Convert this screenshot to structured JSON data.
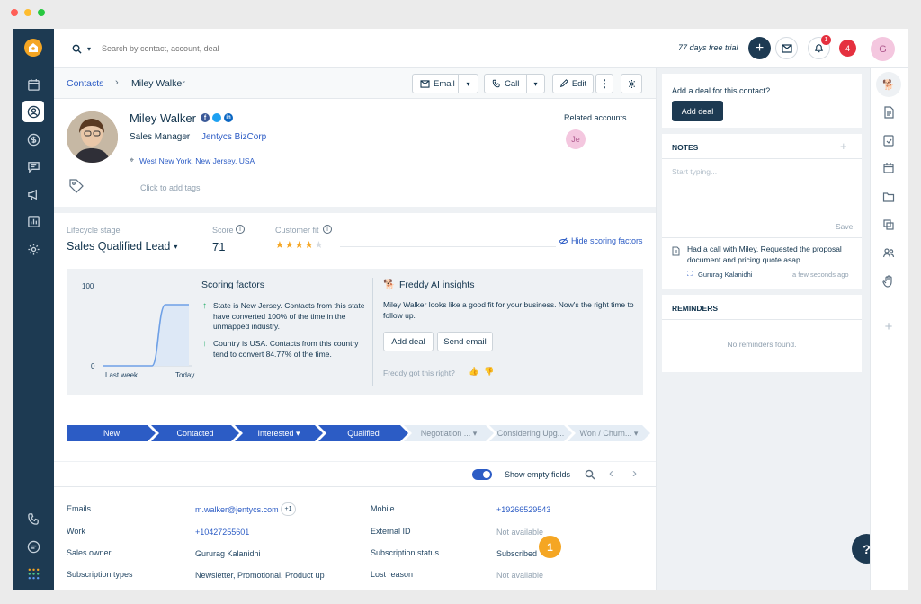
{
  "search": {
    "placeholder": "Search by contact, account, deal"
  },
  "topbar": {
    "trial": "77 days free trial",
    "notif_count": "1",
    "alerts_count": "4",
    "avatar": "G"
  },
  "breadcrumb": {
    "root": "Contacts",
    "current": "Miley Walker"
  },
  "actions": {
    "email": "Email",
    "call": "Call",
    "edit": "Edit"
  },
  "contact": {
    "name": "Miley Walker",
    "title": "Sales Manager",
    "company": "Jentycs BizCorp",
    "location": "West New York, New Jersey, USA",
    "tags_placeholder": "Click to add tags",
    "related_label": "Related accounts",
    "related_avatar": "Je"
  },
  "scoring": {
    "lifecycle_label": "Lifecycle stage",
    "lifecycle_value": "Sales Qualified Lead",
    "score_label": "Score",
    "score_value": "71",
    "fit_label": "Customer fit",
    "fit_stars": 4,
    "fit_max": 5,
    "hide_link": "Hide scoring factors",
    "factors_title": "Scoring factors",
    "factor1": "State is New Jersey. Contacts from this state have converted 100% of the time in the unmapped industry.",
    "factor2": "Country is USA. Contacts from this country tend to convert 84.77% of the time.",
    "y_max": "100",
    "y_min": "0",
    "x_left": "Last week",
    "x_right": "Today"
  },
  "freddy": {
    "title": "Freddy AI insights",
    "text": "Miley Walker looks like a good fit for your business. Now's the right time to follow up.",
    "add_deal": "Add deal",
    "send_email": "Send email",
    "feedback": "Freddy got this right?"
  },
  "pipeline": [
    {
      "label": "New",
      "state": "done"
    },
    {
      "label": "Contacted",
      "state": "done"
    },
    {
      "label": "Interested ▾",
      "state": "done"
    },
    {
      "label": "Qualified",
      "state": "done"
    },
    {
      "label": "Negotiation ... ▾",
      "state": "todo"
    },
    {
      "label": "Considering Upg...",
      "state": "todo"
    },
    {
      "label": "Won / Churn... ▾",
      "state": "todo"
    }
  ],
  "fields_toolbar": {
    "toggle_label": "Show empty fields"
  },
  "fields": {
    "emails_label": "Emails",
    "emails_value": "m.walker@jentycs.com",
    "emails_more": "+1",
    "work_label": "Work",
    "work_value": "+10427255601",
    "owner_label": "Sales owner",
    "owner_value": "Gururag Kalanidhi",
    "subtypes_label": "Subscription types",
    "subtypes_value": "Newsletter, Promotional, Product up",
    "mobile_label": "Mobile",
    "mobile_value": "+19266529543",
    "extid_label": "External ID",
    "extid_value": "Not available",
    "substatus_label": "Subscription status",
    "substatus_value": "Subscribed",
    "lost_label": "Lost reason",
    "lost_value": "Not available",
    "marker": "1"
  },
  "deal": {
    "prompt": "Add a deal for this contact?",
    "button": "Add deal"
  },
  "notes": {
    "title": "NOTES",
    "placeholder": "Start typing...",
    "save": "Save",
    "entry": "Had a call with Miley. Requested the proposal document and pricing quote asap.",
    "author": "Gururag Kalanidhi",
    "time": "a few seconds ago"
  },
  "reminders": {
    "title": "REMINDERS",
    "empty": "No reminders found."
  },
  "help": "?",
  "colors": {
    "nav": "#1d3a52",
    "primary": "#2c5cc5",
    "accent": "#f5a623",
    "danger": "#e5303f"
  }
}
